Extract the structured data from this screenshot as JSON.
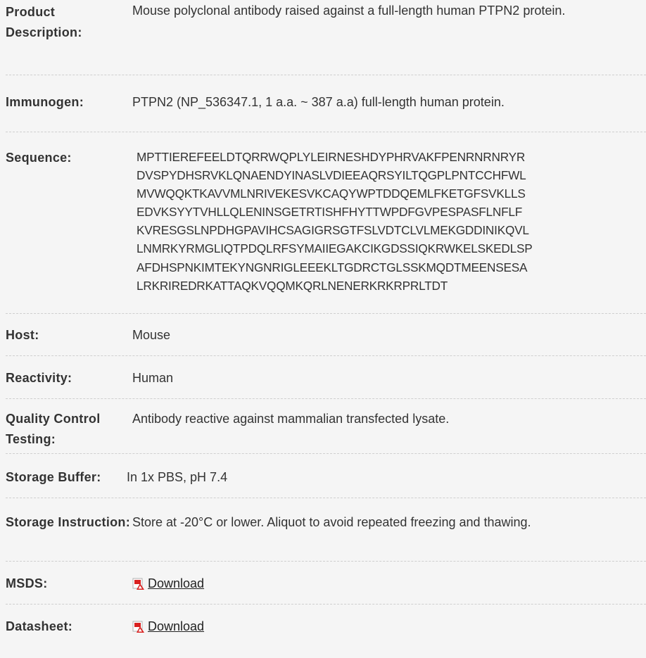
{
  "rows": [
    {
      "label": "Product Description:",
      "value": "Mouse polyclonal antibody raised against a full-length human PTPN2 protein."
    },
    {
      "label": "Immunogen:",
      "value": "PTPN2 (NP_536347.1, 1 a.a. ~ 387 a.a) full-length human protein."
    },
    {
      "label": "Sequence:",
      "lines": [
        "MPTTIEREFEELDTQRRWQPLYLEIRNESHDYPHRVAKFPENRNRNRYR",
        "DVSPYDHSRVKLQNAENDYINASLVDIEEAQRSYILTQGPLPNTCCHFWL",
        "MVWQQKTKAVVMLNRIVEKESVKCAQYWPTDDQEMLFKETGFSVKLLS",
        "EDVKSYYTVHLLQLENINSGETRTISHFHYTTWPDFGVPESPASFLNFLF",
        "KVRESGSLNPDHGPAVIHCSAGIGRSGTFSLVDTCLVLMEKGDDINIKQVL",
        "LNMRKYRMGLIQTPDQLRFSYMAIIEGAKCIKGDSSIQKRWKELSKEDLSP",
        "AFDHSPNKIMTEKYNGNRIGLEEEKLTGDRCTGLSSKMQDTMEENSESA",
        "LRKRIREDRKATTAQKVQQMKQRLNENERKRKRPRLTDT"
      ]
    },
    {
      "label": "Host:",
      "value": "Mouse"
    },
    {
      "label": "Reactivity:",
      "value": "Human"
    },
    {
      "label": "Quality Control Testing:",
      "value": "Antibody reactive against mammalian transfected lysate."
    },
    {
      "label": "Storage Buffer:",
      "value": "In 1x PBS, pH 7.4"
    },
    {
      "label": "Storage Instruction:",
      "value": "Store at -20°C or lower. Aliquot to avoid repeated freezing and thawing."
    },
    {
      "label": "MSDS:",
      "link_label": "Download",
      "icon": "pdf-icon"
    },
    {
      "label": "Datasheet:",
      "link_label": "Download",
      "icon": "pdf-icon"
    }
  ],
  "colors": {
    "background": "#f5f5f5",
    "text": "#333333",
    "divider": "#cfcfcf",
    "pdf_red": "#d9201f"
  }
}
